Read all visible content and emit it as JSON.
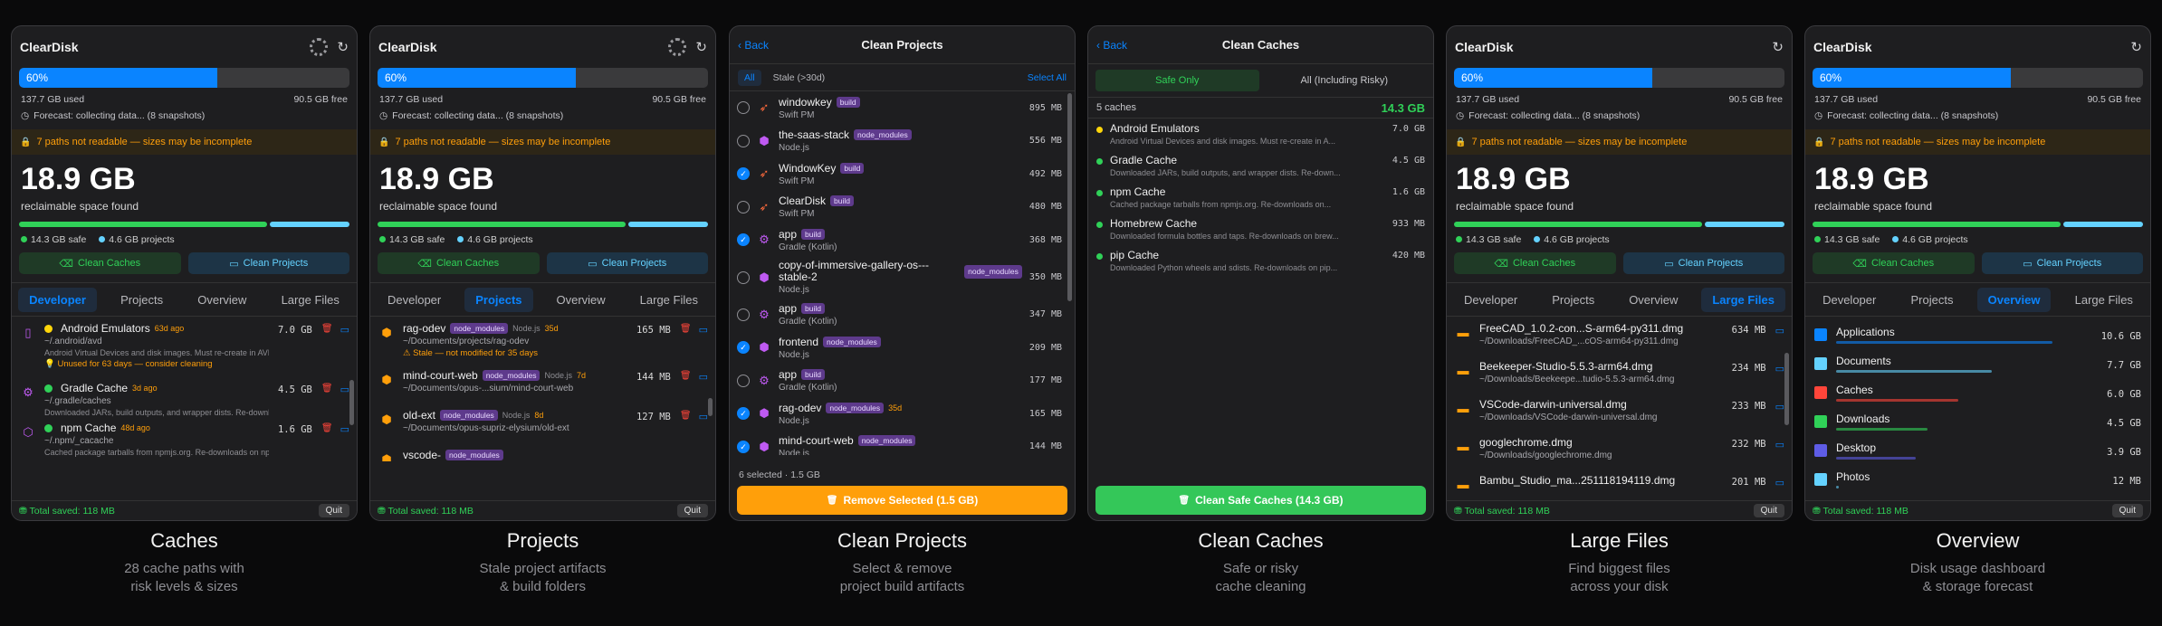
{
  "common": {
    "app_title": "ClearDisk",
    "usage_pct": "60%",
    "used": "137.7 GB used",
    "free": "90.5 GB free",
    "forecast": "Forecast: collecting data... (8 snapshots)",
    "warning": "7 paths not readable — sizes may be incomplete",
    "reclaim": "18.9 GB",
    "reclaim_sub": "reclaimable space found",
    "safe_legend": "14.3 GB safe",
    "proj_legend": "4.6 GB projects",
    "clean_caches": "Clean Caches",
    "clean_projects": "Clean Projects",
    "tabs": [
      "Developer",
      "Projects",
      "Overview",
      "Large Files"
    ],
    "total_saved": "Total saved: 118 MB",
    "quit": "Quit",
    "colors": {
      "accent": "#0a84ff",
      "green": "#30d158",
      "orange": "#ff9f0a",
      "cyan": "#64d2ff"
    }
  },
  "captions": [
    {
      "title": "Caches",
      "sub": "28 cache paths with\nrisk levels & sizes"
    },
    {
      "title": "Projects",
      "sub": "Stale project artifacts\n& build folders"
    },
    {
      "title": "Clean Projects",
      "sub": "Select & remove\nproject build artifacts"
    },
    {
      "title": "Clean Caches",
      "sub": "Safe or risky\ncache cleaning"
    },
    {
      "title": "Large Files",
      "sub": "Find biggest files\nacross your disk"
    },
    {
      "title": "Overview",
      "sub": "Disk usage dashboard\n& storage forecast"
    }
  ],
  "caches_list": [
    {
      "name": "Android Emulators",
      "age": "63d ago",
      "path": "~/.android/avd",
      "desc": "Android Virtual Devices and disk images. Must re-create in AVD Ma...",
      "warn": "Unused for 63 days — consider cleaning",
      "size": "7.0 GB",
      "icon": "android-icon"
    },
    {
      "name": "Gradle Cache",
      "age": "3d ago",
      "path": "~/.gradle/caches",
      "desc": "Downloaded JARs, build outputs, and wrapper dists. Re-downloads...",
      "size": "4.5 GB",
      "icon": "gear-icon"
    },
    {
      "name": "npm Cache",
      "age": "48d ago",
      "path": "~/.npm/_cacache",
      "desc": "Cached package tarballs from npmjs.org. Re-downloads on npm ins...",
      "size": "1.6 GB",
      "icon": "package-icon"
    }
  ],
  "projects_list": [
    {
      "name": "rag-odev",
      "tag": "node_modules",
      "kind": "Node.js",
      "age": "35d",
      "path": "~/Documents/projects/rag-odev",
      "warn": "Stale — not modified for 35 days",
      "size": "165 MB"
    },
    {
      "name": "mind-court-web",
      "tag": "node_modules",
      "kind": "Node.js",
      "age": "7d",
      "path": "~/Documents/opus-...sium/mind-court-web",
      "size": "144 MB"
    },
    {
      "name": "old-ext",
      "tag": "node_modules",
      "kind": "Node.js",
      "age": "8d",
      "path": "~/Documents/opus-supriz-elysium/old-ext",
      "size": "127 MB"
    },
    {
      "name": "vscode-",
      "tag": "node_modules",
      "kind": "",
      "age": "",
      "path": "",
      "size": ""
    }
  ],
  "clean_projects": {
    "back": "Back",
    "title": "Clean Projects",
    "all": "All",
    "stale": "Stale (>30d)",
    "select_all": "Select All",
    "status": "6 selected · 1.5 GB",
    "action": "Remove Selected (1.5 GB)",
    "rows": [
      {
        "name": "windowkey",
        "tag": "build",
        "kind": "Swift PM",
        "size": "895 MB",
        "on": false,
        "icon": "swift"
      },
      {
        "name": "the-saas-stack",
        "tag": "node_modules",
        "kind": "Node.js",
        "size": "556 MB",
        "on": false,
        "icon": "node"
      },
      {
        "name": "WindowKey",
        "tag": "build",
        "kind": "Swift PM",
        "size": "492 MB",
        "on": true,
        "icon": "swift"
      },
      {
        "name": "ClearDisk",
        "tag": "build",
        "kind": "Swift PM",
        "size": "480 MB",
        "on": false,
        "icon": "swift"
      },
      {
        "name": "app",
        "tag": "build",
        "kind": "Gradle (Kotlin)",
        "size": "368 MB",
        "on": true,
        "icon": "gear"
      },
      {
        "name": "copy-of-immersive-gallery-os---stable-2",
        "tag": "node_modules",
        "kind": "Node.js",
        "size": "350 MB",
        "on": false,
        "icon": "node"
      },
      {
        "name": "app",
        "tag": "build",
        "kind": "Gradle (Kotlin)",
        "size": "347 MB",
        "on": false,
        "icon": "gear"
      },
      {
        "name": "frontend",
        "tag": "node_modules",
        "kind": "Node.js",
        "size": "209 MB",
        "on": true,
        "icon": "node"
      },
      {
        "name": "app",
        "tag": "build",
        "kind": "Gradle (Kotlin)",
        "size": "177 MB",
        "on": false,
        "icon": "gear"
      },
      {
        "name": "rag-odev",
        "tag": "node_modules",
        "age": "35d",
        "kind": "Node.js",
        "size": "165 MB",
        "on": true,
        "icon": "node"
      },
      {
        "name": "mind-court-web",
        "tag": "node_modules",
        "kind": "Node.js",
        "size": "144 MB",
        "on": true,
        "icon": "node"
      }
    ]
  },
  "clean_caches": {
    "back": "Back",
    "title": "Clean Caches",
    "safe": "Safe Only",
    "all": "All (Including Risky)",
    "count": "5 caches",
    "total": "14.3 GB",
    "action": "Clean Safe Caches (14.3 GB)",
    "rows": [
      {
        "name": "Android Emulators",
        "desc": "Android Virtual Devices and disk images. Must re-create in A...",
        "size": "7.0 GB",
        "color": "#ffd60a"
      },
      {
        "name": "Gradle Cache",
        "desc": "Downloaded JARs, build outputs, and wrapper dists. Re-down...",
        "size": "4.5 GB",
        "color": "#30d158"
      },
      {
        "name": "npm Cache",
        "desc": "Cached package tarballs from npmjs.org. Re-downloads on...",
        "size": "1.6 GB",
        "color": "#30d158"
      },
      {
        "name": "Homebrew Cache",
        "desc": "Downloaded formula bottles and taps. Re-downloads on brew...",
        "size": "933 MB",
        "color": "#30d158"
      },
      {
        "name": "pip Cache",
        "desc": "Downloaded Python wheels and sdists. Re-downloads on pip...",
        "size": "420 MB",
        "color": "#30d158"
      }
    ]
  },
  "large_files": [
    {
      "name": "FreeCAD_1.0.2-con...S-arm64-py311.dmg",
      "path": "~/Downloads/FreeCAD_...cOS-arm64-py311.dmg",
      "size": "634 MB"
    },
    {
      "name": "Beekeeper-Studio-5.5.3-arm64.dmg",
      "path": "~/Downloads/Beekeepe...tudio-5.5.3-arm64.dmg",
      "size": "234 MB"
    },
    {
      "name": "VSCode-darwin-universal.dmg",
      "path": "~/Downloads/VSCode-darwin-universal.dmg",
      "size": "233 MB"
    },
    {
      "name": "googlechrome.dmg",
      "path": "~/Downloads/googlechrome.dmg",
      "size": "232 MB"
    },
    {
      "name": "Bambu_Studio_ma...251118194119.dmg",
      "path": "",
      "size": "201 MB"
    }
  ],
  "overview": [
    {
      "name": "Applications",
      "size": "10.6 GB",
      "color": "#0a84ff",
      "frac": 0.92
    },
    {
      "name": "Documents",
      "size": "7.7 GB",
      "color": "#64d2ff",
      "frac": 0.66
    },
    {
      "name": "Caches",
      "size": "6.0 GB",
      "color": "#ff453a",
      "frac": 0.52
    },
    {
      "name": "Downloads",
      "size": "4.5 GB",
      "color": "#30d158",
      "frac": 0.39
    },
    {
      "name": "Desktop",
      "size": "3.9 GB",
      "color": "#5e5ce6",
      "frac": 0.34
    },
    {
      "name": "Photos",
      "size": "12 MB",
      "color": "#64d2ff",
      "frac": 0.01
    }
  ]
}
